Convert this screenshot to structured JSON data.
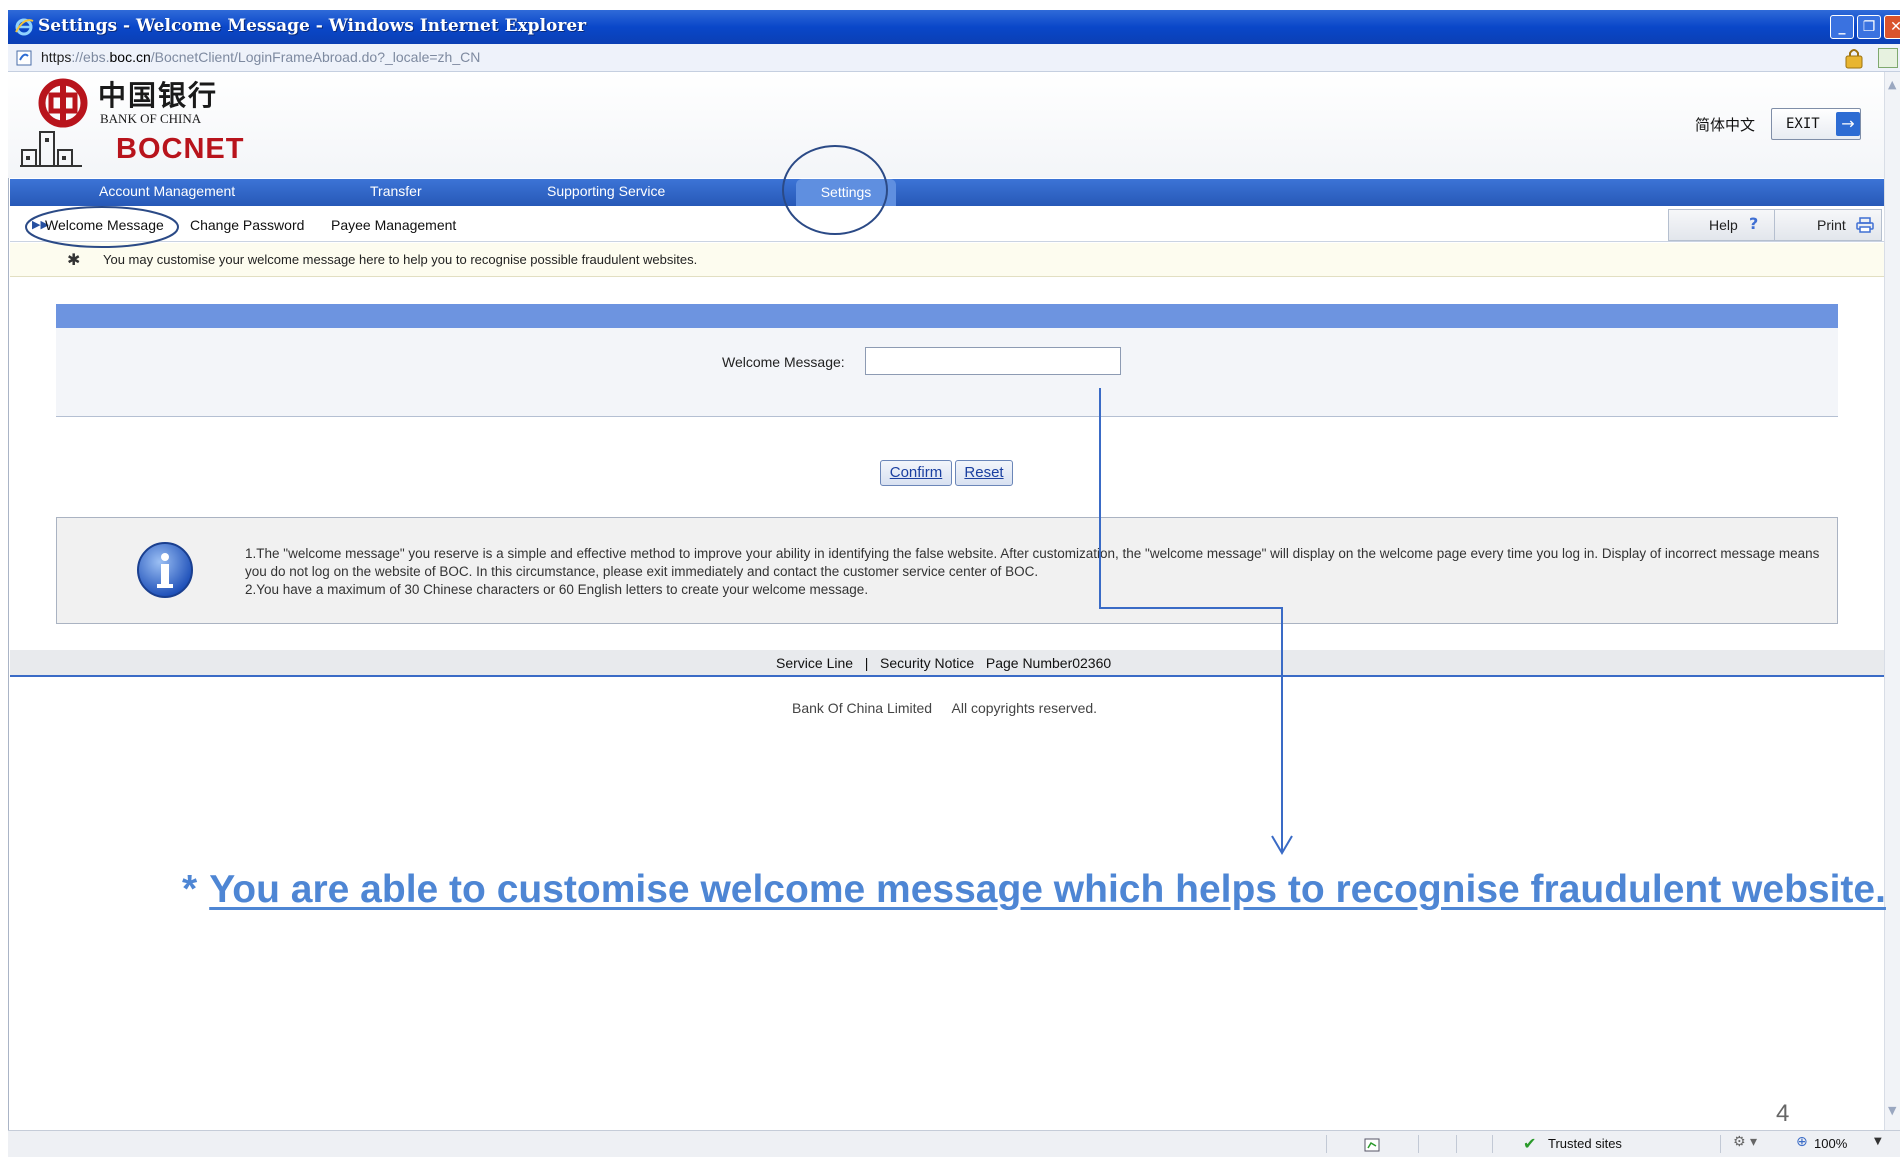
{
  "window": {
    "title": "Settings - Welcome Message - Windows Internet Explorer",
    "url_scheme": "https",
    "url_sep": "://ebs.",
    "url_domain": "boc.cn",
    "url_path": "/BocnetClient/LoginFrameAbroad.do?_locale=zh_CN",
    "min_label": "_",
    "max_label": "❐",
    "close_label": "✕"
  },
  "header": {
    "logo_cn": "中国银行",
    "logo_en": "BANK OF CHINA",
    "bocnet_title": "BOCNET",
    "lang_link": "简体中文",
    "exit_label": "EXIT",
    "exit_icon": "→"
  },
  "main_nav": {
    "items": [
      {
        "label": "Account Management"
      },
      {
        "label": "Transfer"
      },
      {
        "label": "Supporting Service"
      },
      {
        "label": "Settings"
      }
    ]
  },
  "sub_nav": {
    "items": [
      {
        "label": "Welcome Message"
      },
      {
        "label": "Change Password"
      },
      {
        "label": "Payee Management"
      }
    ],
    "help_label": "Help",
    "help_mark": "?",
    "print_label": "Print"
  },
  "tip": {
    "text": "You may customise your welcome message here to help you to recognise possible fraudulent websites."
  },
  "form": {
    "welcome_label": "Welcome Message:",
    "welcome_value": "",
    "confirm_label": "Confirm",
    "reset_label": "Reset"
  },
  "info": {
    "line1": "1.The \"welcome message\" you reserve is a simple and effective method to improve your ability in identifying the false website. After customization, the \"welcome message\" will display on the welcome page every time you log in. Display of incorrect message means you do not log on the website of BOC. In this circumstance, please exit immediately and contact the customer service center of BOC.",
    "line2": "2.You have a maximum of 30 Chinese characters or 60 English letters to create your welcome message."
  },
  "footer": {
    "service_line": "Service Line",
    "separator": "|",
    "security_notice": "Security Notice",
    "page_number": "Page Number02360",
    "company": "Bank Of China Limited",
    "rights": "All copyrights reserved."
  },
  "annotation": {
    "star": "*",
    "callout": "You are able to customise welcome message which helps to recognise fraudulent website.",
    "color": "#4e86d4"
  },
  "status_bar": {
    "zone_label": "Trusted sites",
    "zoom": "100%"
  },
  "slide_number": "4",
  "colors": {
    "nav_blue": "#2759b7",
    "brand_red": "#b8141c",
    "panel_blue": "#6d94e0"
  }
}
